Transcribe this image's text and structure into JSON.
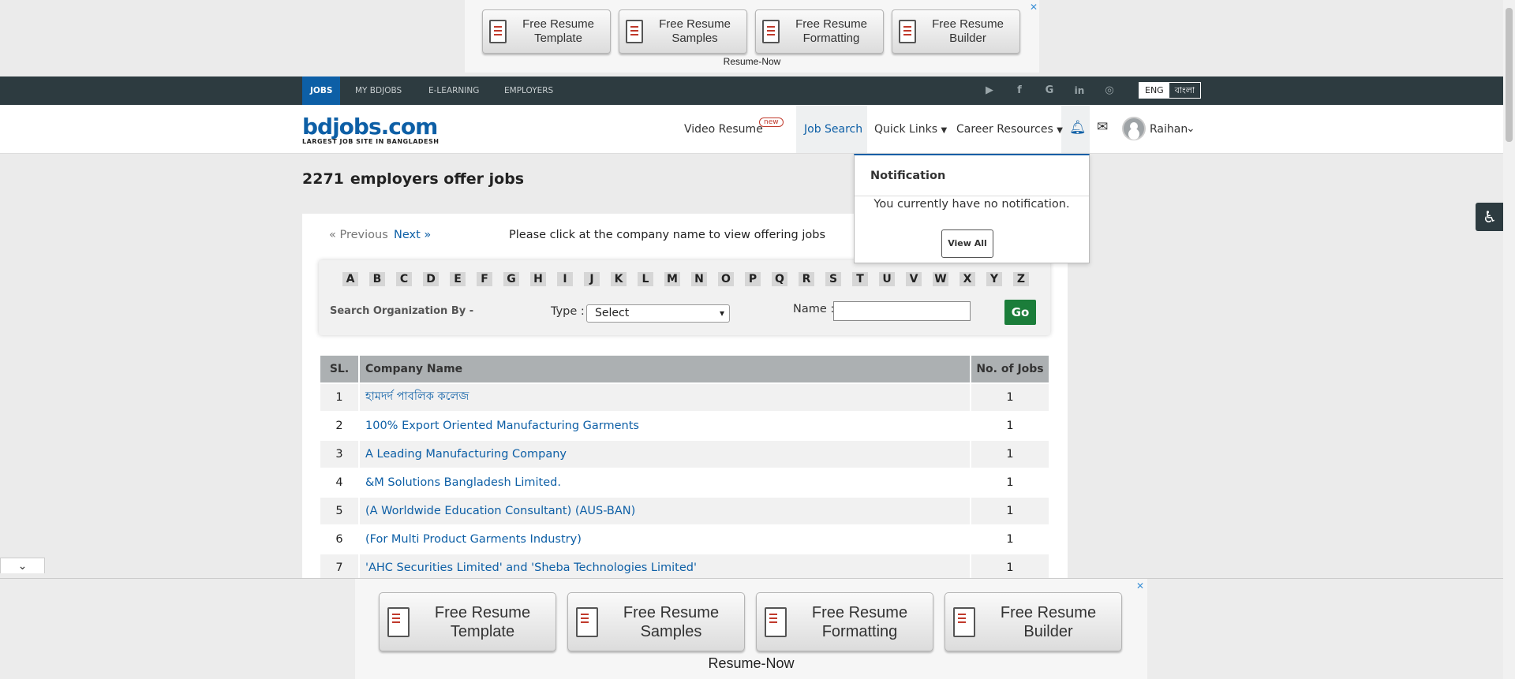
{
  "top_ad": {
    "buttons": [
      "Free Resume\nTemplate",
      "Free Resume\nSamples",
      "Free Resume\nFormatting",
      "Free Resume\nBuilder"
    ],
    "brand": "Resume-Now",
    "close": "✕"
  },
  "topnav": {
    "tabs": [
      "JOBS",
      "MY BDJOBS",
      "E-LEARNING",
      "EMPLOYERS"
    ],
    "social_icons": [
      "youtube-icon",
      "facebook-icon",
      "google-icon",
      "linkedin-icon",
      "instagram-icon"
    ],
    "lang": {
      "en": "ENG",
      "bn": "বাংলা"
    }
  },
  "header": {
    "logo_text": "bdjobs.com",
    "logo_tagline": "LARGEST JOB SITE IN BANGLADESH",
    "video_resume": "Video Resume",
    "new_badge": "new",
    "job_search": "Job Search",
    "quick_links": "Quick Links",
    "career_resources": "Career Resources",
    "user_name": "Raihan"
  },
  "page": {
    "count": "2271",
    "title": "employers offer jobs",
    "prev": "« Previous",
    "next": "Next »",
    "instruction": "Please click at the company name to view offering jobs"
  },
  "filter": {
    "letters": [
      "A",
      "B",
      "C",
      "D",
      "E",
      "F",
      "G",
      "H",
      "I",
      "J",
      "K",
      "L",
      "M",
      "N",
      "O",
      "P",
      "Q",
      "R",
      "S",
      "T",
      "U",
      "V",
      "W",
      "X",
      "Y",
      "Z"
    ],
    "search_by": "Search Organization By -",
    "type_label": "Type :",
    "type_value": "Select",
    "name_label": "Name :",
    "go": "Go"
  },
  "table": {
    "headers": {
      "sl": "SL.",
      "company": "Company Name",
      "jobs": "No. of Jobs"
    },
    "rows": [
      {
        "sl": "1",
        "company": "হামদর্দ পাবলিক কলেজ",
        "jobs": "1"
      },
      {
        "sl": "2",
        "company": "100% Export Oriented Manufacturing Garments",
        "jobs": "1"
      },
      {
        "sl": "3",
        "company": "A Leading Manufacturing Company",
        "jobs": "1"
      },
      {
        "sl": "4",
        "company": "&M Solutions Bangladesh Limited.",
        "jobs": "1"
      },
      {
        "sl": "5",
        "company": "(A Worldwide Education Consultant) (AUS-BAN)",
        "jobs": "1"
      },
      {
        "sl": "6",
        "company": "(For Multi Product Garments Industry)",
        "jobs": "1"
      },
      {
        "sl": "7",
        "company": "'AHC Securities Limited' and 'Sheba Technologies Limited'",
        "jobs": "1"
      }
    ]
  },
  "notification": {
    "title": "Notification",
    "message": "You currently have no notification.",
    "view_all": "View All"
  },
  "bottom_ad": {
    "buttons": [
      "Free Resume\nTemplate",
      "Free Resume\nSamples",
      "Free Resume\nFormatting",
      "Free Resume\nBuilder"
    ],
    "brand": "Resume-Now",
    "close": "✕"
  },
  "colors": {
    "nav_dark": "#2d3b40",
    "brand_blue": "#0d5fa6",
    "go_green": "#1b7d3a",
    "logo_orange": "#f08a1c"
  }
}
